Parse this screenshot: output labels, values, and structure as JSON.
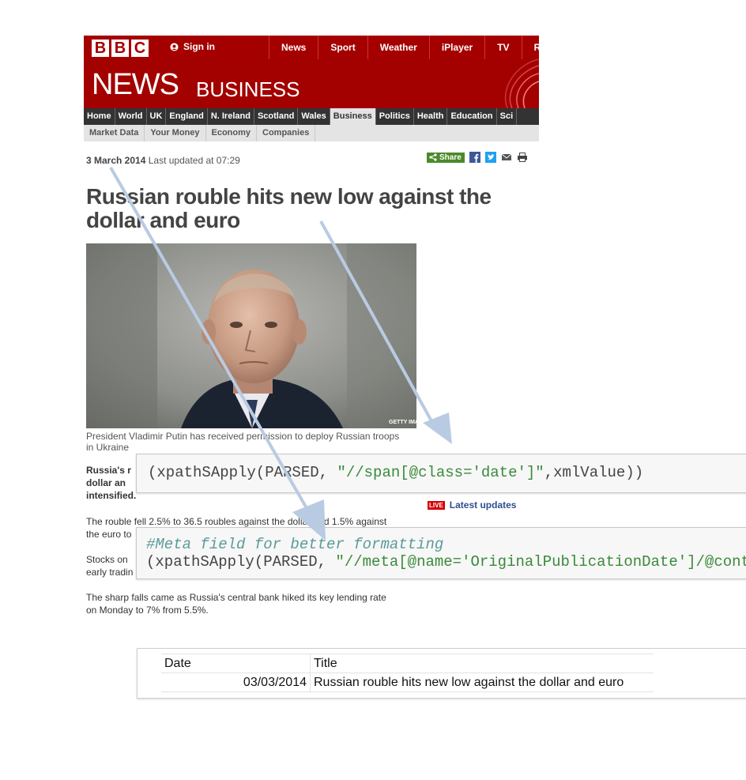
{
  "bbc": {
    "logo_letters": [
      "B",
      "B",
      "C"
    ],
    "sign_in": "Sign in",
    "top_nav": [
      "News",
      "Sport",
      "Weather",
      "iPlayer",
      "TV",
      "Ra"
    ],
    "news_word": "NEWS",
    "section_word": "BUSINESS",
    "main_nav": [
      "Home",
      "World",
      "UK",
      "England",
      "N. Ireland",
      "Scotland",
      "Wales",
      "Business",
      "Politics",
      "Health",
      "Education",
      "Sci"
    ],
    "main_nav_active": "Business",
    "sub_nav": [
      "Market Data",
      "Your Money",
      "Economy",
      "Companies"
    ],
    "colors": {
      "brand_red": "#a50000",
      "nav_dark": "#333333",
      "share_green": "#4a8a2a"
    }
  },
  "article": {
    "date": "3 March 2014",
    "updated": "Last updated at 07:29",
    "share_label": "Share",
    "share_icons": [
      "facebook-icon",
      "twitter-icon",
      "email-icon",
      "print-icon"
    ],
    "headline_line1": "Russian rouble hits new low against the",
    "headline_line2": "dollar and euro",
    "photo_credit": "GETTY IMAGES",
    "caption_line1": "President Vladimir Putin has received permission to deploy Russian troops",
    "caption_line2": "in Ukraine",
    "intro_lines": [
      "Russia's r",
      "dollar an",
      "intensified."
    ],
    "para1_lines": [
      "The rouble fell 2.5% to 36.5 roubles against the dollar and 1.5% against",
      "the euro to"
    ],
    "para2_lines": [
      "Stocks on",
      "early tradin"
    ],
    "para3_lines": [
      "The sharp falls came as Russia's central bank hiked its key lending rate",
      "on Monday to 7% from 5.5%."
    ],
    "live_badge": "LIVE",
    "latest_updates": "Latest updates"
  },
  "code": {
    "line1_prefix": "(xpathSApply(PARSED, ",
    "line1_string": "\"//span[@class='date']\"",
    "line1_suffix": ",xmlValue))",
    "comment": "#Meta field for better formatting",
    "line2_prefix": "(xpathSApply(PARSED, ",
    "line2_string": "\"//meta[@name='OriginalPublicationDate']/@conte"
  },
  "result_table": {
    "headers": [
      "Date",
      "Title"
    ],
    "rows": [
      [
        "03/03/2014",
        "Russian rouble hits new low against the dollar and euro"
      ]
    ]
  }
}
